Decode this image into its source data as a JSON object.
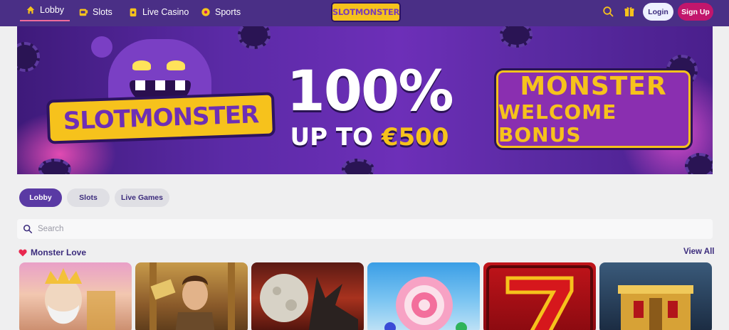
{
  "nav": {
    "items": [
      {
        "label": "Lobby",
        "icon": "home-icon",
        "active": true
      },
      {
        "label": "Slots",
        "icon": "slot-machine-icon",
        "active": false
      },
      {
        "label": "Live Casino",
        "icon": "card-icon",
        "active": false
      },
      {
        "label": "Sports",
        "icon": "ball-icon",
        "active": false
      }
    ],
    "logo_text": "SLOTMONSTER",
    "login_label": "Login",
    "signup_label": "Sign Up"
  },
  "banner": {
    "brand_text": "SLOTMONSTER",
    "headline": "100%",
    "subline_prefix": "UP TO ",
    "subline_amount": "€500",
    "bonus_line1": "MONSTER",
    "bonus_line2": "WELCOME BONUS"
  },
  "tabs": [
    {
      "label": "Lobby",
      "active": true
    },
    {
      "label": "Slots",
      "active": false
    },
    {
      "label": "Live Games",
      "active": false
    }
  ],
  "search": {
    "placeholder": "Search",
    "value": ""
  },
  "section": {
    "title": "Monster Love",
    "view_all_label": "View All"
  },
  "colors": {
    "nav_bg": "#4a2f86",
    "accent_pink": "#c2166c",
    "brand_yellow": "#f6c21c",
    "text_purple": "#3b2b7c"
  }
}
